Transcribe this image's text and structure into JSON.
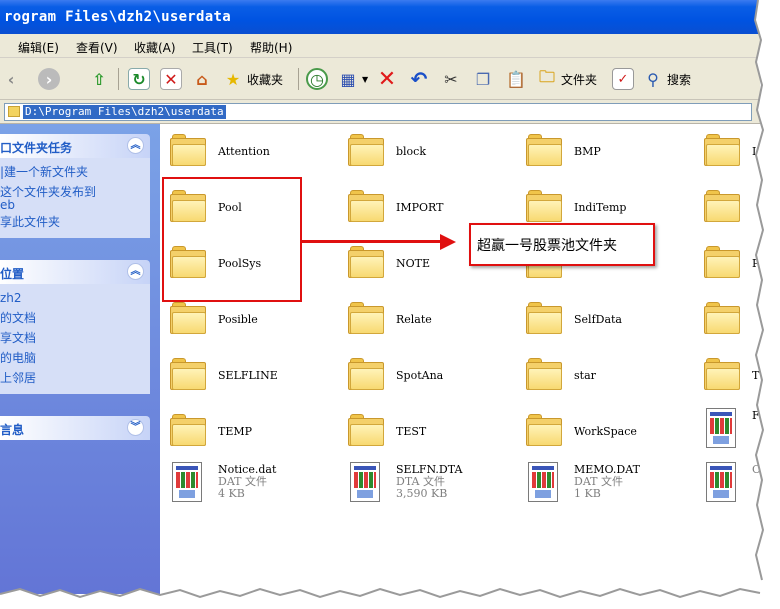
{
  "window": {
    "title": "rogram Files\\dzh2\\userdata"
  },
  "menu": [
    "编辑(E)",
    "查看(V)",
    "收藏(A)",
    "工具(T)",
    "帮助(H)"
  ],
  "toolbar": {
    "favorites_label": "收藏夹",
    "folders_label": "文件夹",
    "search_label": "搜索"
  },
  "address": {
    "value": "D:\\Program Files\\dzh2\\userdata"
  },
  "leftpane": {
    "tasks": {
      "title": "口文件夹任务",
      "items": [
        "|建一个新文件夹",
        "这个文件夹发布到",
        "eb",
        "享此文件夹"
      ]
    },
    "places": {
      "title": "位置",
      "items": [
        "zh2",
        "的文档",
        "享文档",
        "的电脑",
        "上邻居"
      ]
    },
    "details": {
      "title": "言息"
    }
  },
  "items": [
    {
      "kind": "folder",
      "name": "Attention"
    },
    {
      "kind": "folder",
      "name": "block"
    },
    {
      "kind": "folder",
      "name": "BMP"
    },
    {
      "kind": "folder",
      "name": "I"
    },
    {
      "kind": "folder",
      "name": "Pool"
    },
    {
      "kind": "folder",
      "name": "IMPORT"
    },
    {
      "kind": "folder",
      "name": "IndiTemp"
    },
    {
      "kind": "folder",
      "name": ""
    },
    {
      "kind": "folder",
      "name": "PoolSys"
    },
    {
      "kind": "folder",
      "name": "NOTE"
    },
    {
      "kind": "folder",
      "name": ""
    },
    {
      "kind": "folder",
      "name": "P"
    },
    {
      "kind": "folder",
      "name": "Posible"
    },
    {
      "kind": "folder",
      "name": "Relate"
    },
    {
      "kind": "folder",
      "name": "SelfData"
    },
    {
      "kind": "folder",
      "name": ""
    },
    {
      "kind": "folder",
      "name": "SELFLINE"
    },
    {
      "kind": "folder",
      "name": "SpotAna"
    },
    {
      "kind": "folder",
      "name": "star"
    },
    {
      "kind": "folder",
      "name": "T"
    },
    {
      "kind": "folder",
      "name": "TEMP"
    },
    {
      "kind": "folder",
      "name": "TEST"
    },
    {
      "kind": "folder",
      "name": "WorkSpace"
    },
    {
      "kind": "file",
      "name": "F",
      "type": "",
      "size": ""
    },
    {
      "kind": "file",
      "name": "Notice.dat",
      "type": "DAT 文件",
      "size": "4 KB"
    },
    {
      "kind": "file",
      "name": "SELFN.DTA",
      "type": "DTA 文件",
      "size": "3,590 KB"
    },
    {
      "kind": "file",
      "name": "MEMO.DAT",
      "type": "DAT 文件",
      "size": "1 KB"
    },
    {
      "kind": "file",
      "name": "",
      "type": "C",
      "size": ""
    }
  ],
  "callout": {
    "text": "超赢一号股票池文件夹"
  }
}
